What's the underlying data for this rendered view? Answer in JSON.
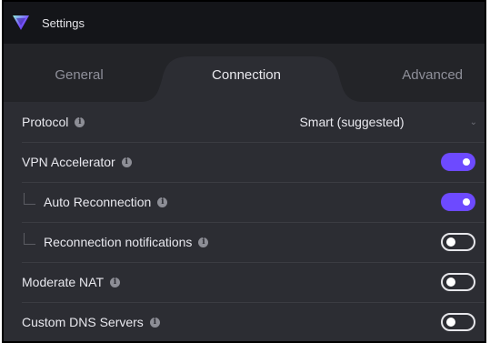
{
  "window": {
    "title": "Settings"
  },
  "tabs": [
    {
      "label": "General",
      "active": false
    },
    {
      "label": "Connection",
      "active": true
    },
    {
      "label": "Advanced",
      "active": false
    }
  ],
  "settings": {
    "protocol": {
      "label": "Protocol",
      "value": "Smart (suggested)"
    },
    "vpn_accelerator": {
      "label": "VPN Accelerator",
      "enabled": true
    },
    "auto_reconnection": {
      "label": "Auto Reconnection",
      "enabled": true
    },
    "reconnection_notifications": {
      "label": "Reconnection notifications",
      "enabled": false
    },
    "moderate_nat": {
      "label": "Moderate NAT",
      "enabled": false
    },
    "custom_dns": {
      "label": "Custom DNS Servers",
      "enabled": false
    }
  },
  "colors": {
    "accent": "#6d4aff",
    "background": "#2c2d33",
    "titlebar": "#141519"
  }
}
